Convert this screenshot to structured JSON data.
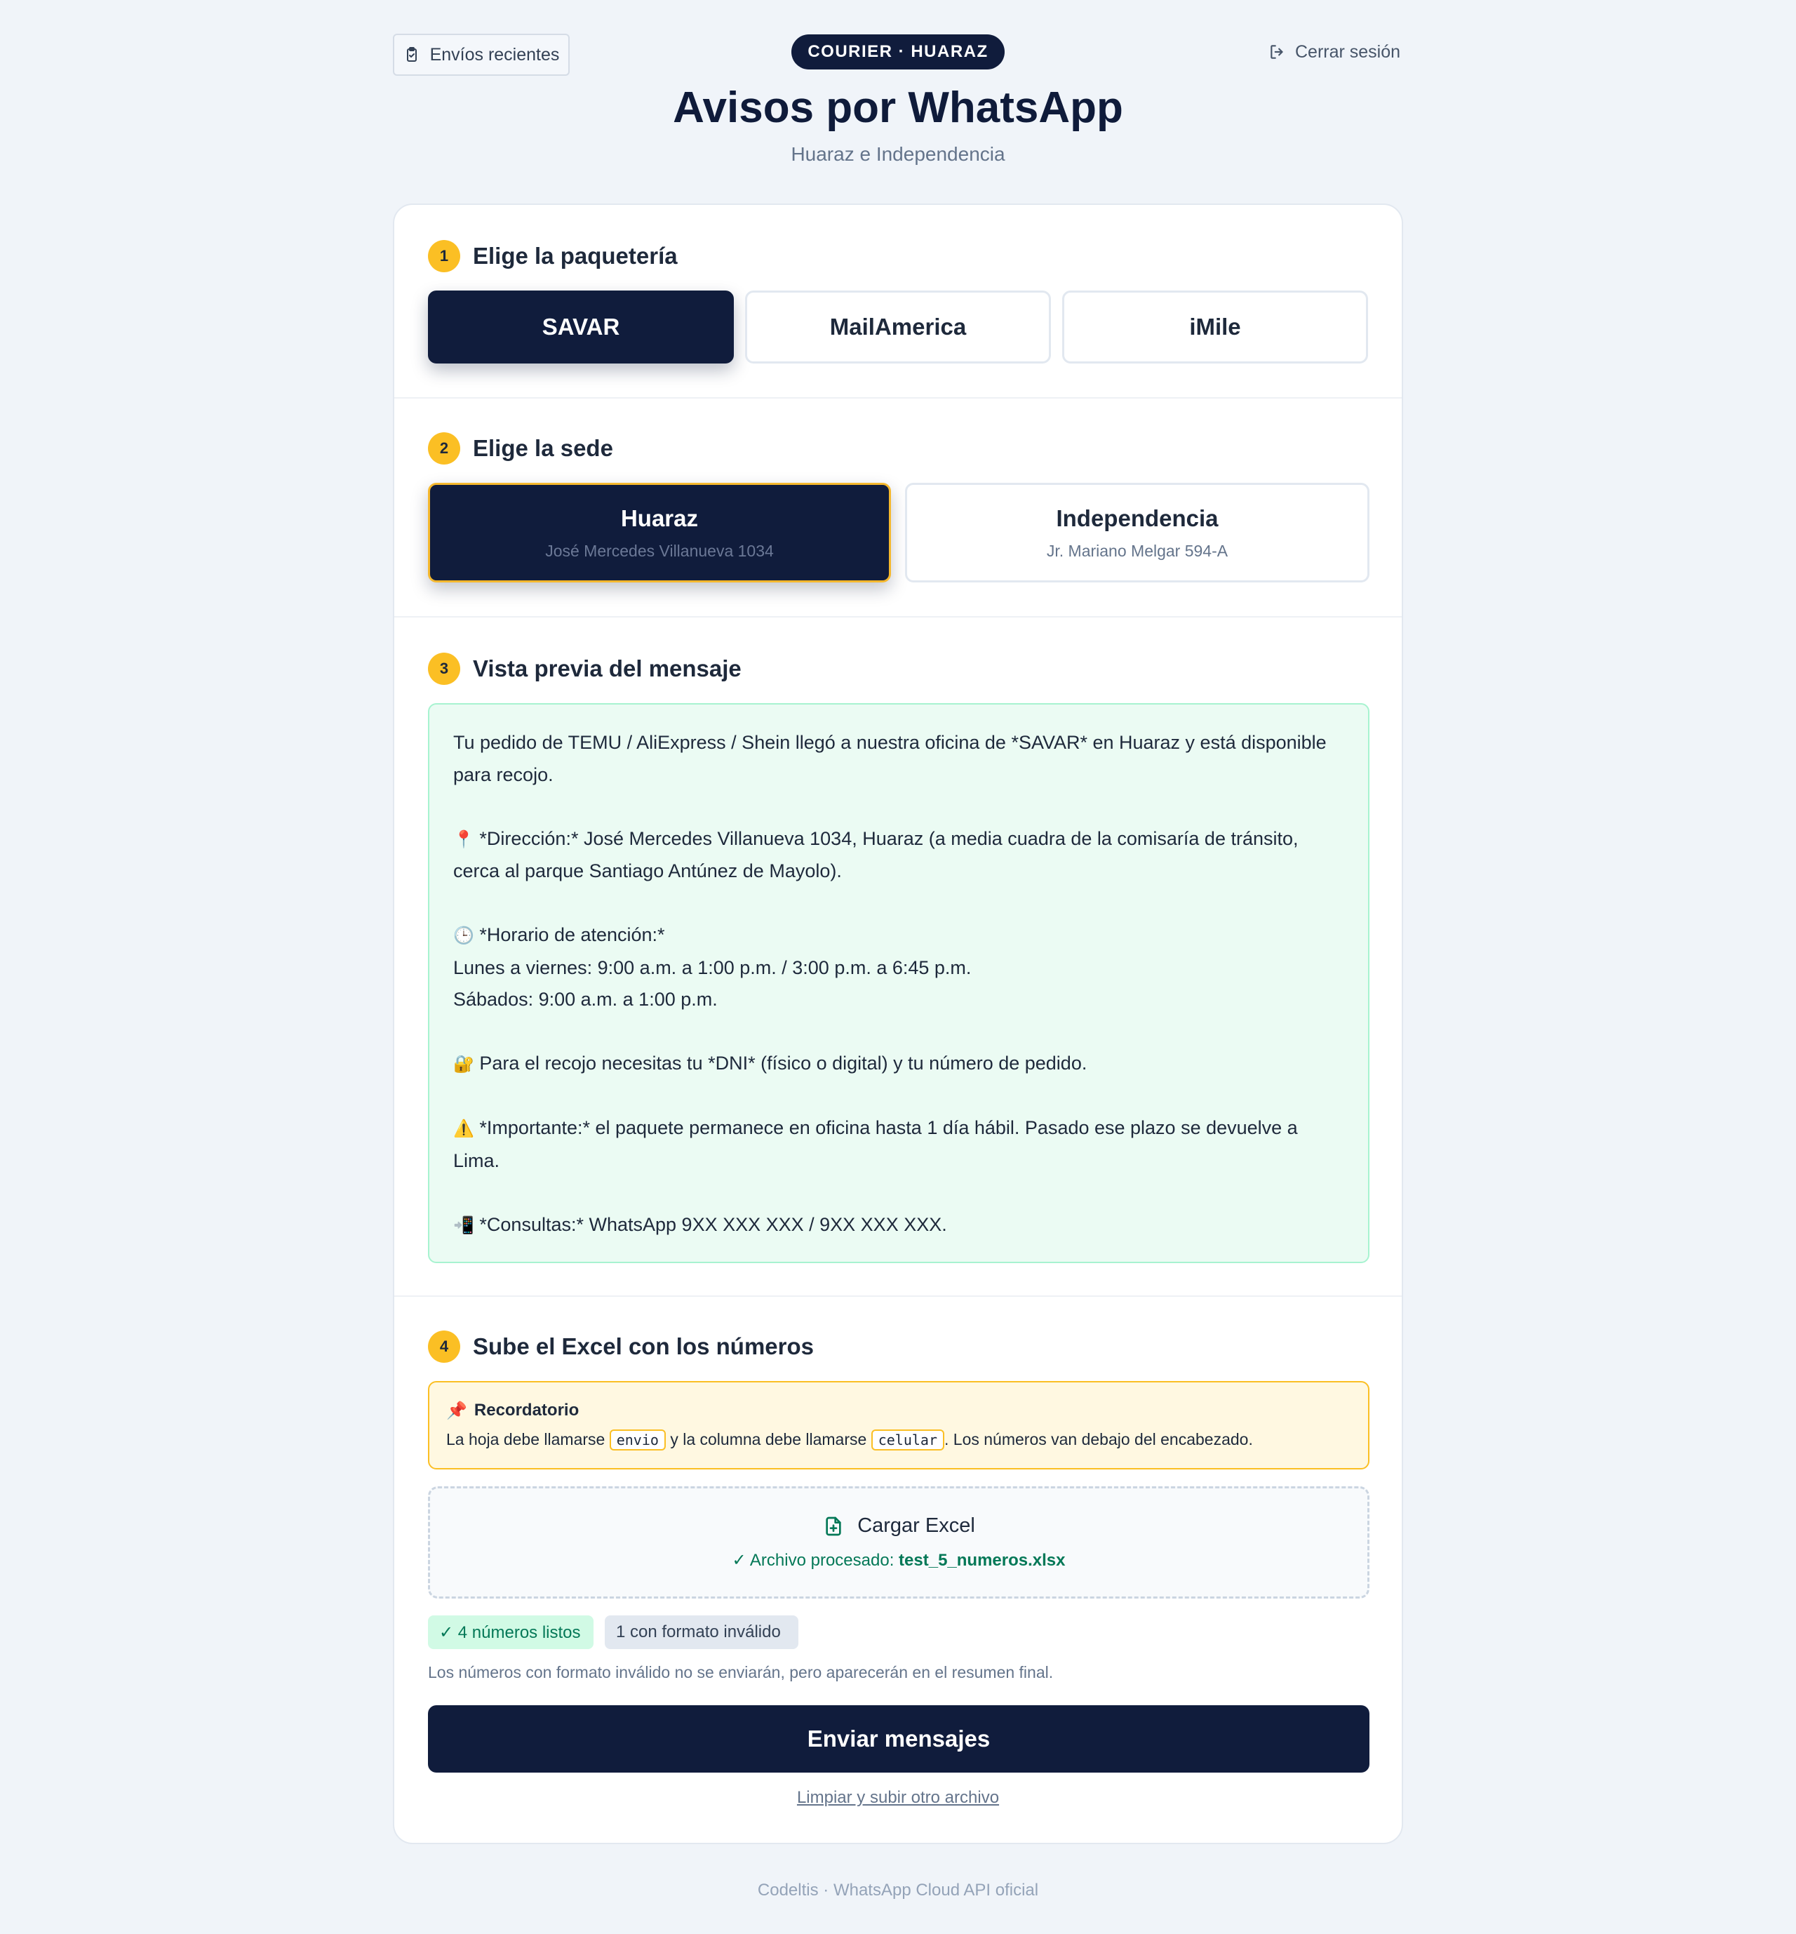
{
  "header": {
    "recent_label": "Envíos recientes",
    "badge": "COURIER · HUARAZ",
    "logout_label": "Cerrar sesión",
    "title": "Avisos por WhatsApp",
    "subtitle": "Huaraz e Independencia"
  },
  "steps": [
    {
      "num": "1",
      "title": "Elige la paquetería"
    },
    {
      "num": "2",
      "title": "Elige la sede"
    },
    {
      "num": "3",
      "title": "Vista previa del mensaje"
    },
    {
      "num": "4",
      "title": "Sube el Excel con los números"
    }
  ],
  "carriers": [
    {
      "label": "SAVAR",
      "selected": true
    },
    {
      "label": "MailAmerica",
      "selected": false
    },
    {
      "label": "iMile",
      "selected": false
    }
  ],
  "sedes": [
    {
      "name": "Huaraz",
      "address": "José Mercedes Villanueva 1034",
      "selected": true
    },
    {
      "name": "Independencia",
      "address": "Jr. Mariano Melgar 594-A",
      "selected": false
    }
  ],
  "preview": {
    "p1": "Tu pedido de TEMU / AliExpress / Shein llegó a nuestra oficina de *SAVAR* en Huaraz y está disponible para recojo.",
    "p2_icon": "📍",
    "p2": "*Dirección:* José Mercedes Villanueva 1034, Huaraz (a media cuadra de la comisaría de tránsito, cerca al parque Santiago Antúnez de Mayolo).",
    "p3_icon": "🕒",
    "p3": "*Horario de atención:*",
    "p3_line2": "Lunes a viernes: 9:00 a.m. a 1:00 p.m. / 3:00 p.m. a 6:45 p.m.",
    "p3_line3": "Sábados: 9:00 a.m. a 1:00 p.m.",
    "p4_icon": "🔐",
    "p4": "Para el recojo necesitas tu *DNI* (físico o digital) y tu número de pedido.",
    "p5_icon": "⚠️",
    "p5": "*Importante:* el paquete permanece en oficina hasta 1 día hábil. Pasado ese plazo se devuelve a Lima.",
    "p6_icon": "📲",
    "p6": "*Consultas:* WhatsApp 9XX XXX XXX / 9XX XXX XXX."
  },
  "reminder": {
    "icon": "📌",
    "title": "Recordatorio",
    "text_a": "La hoja debe llamarse",
    "code_sheet": "envio",
    "text_b": "y la columna debe llamarse",
    "code_col": "celular",
    "text_c": ". Los números van debajo del encabezado."
  },
  "upload": {
    "label": "Cargar Excel",
    "status_prefix": "✓ Archivo procesado:",
    "filename": "test_5_numeros.xlsx"
  },
  "counts": {
    "ok": "✓ 4 números listos",
    "invalid": "1 con formato inválido",
    "note": "Los números con formato inválido no se enviarán, pero aparecerán en el resumen final."
  },
  "actions": {
    "send": "Enviar mensajes",
    "clear": "Limpiar y subir otro archivo"
  },
  "footer": "Codeltis · WhatsApp Cloud API oficial",
  "colors": {
    "navy": "#101c3c",
    "accent": "#fbbf24",
    "preview_bg": "#ebfbf3",
    "success": "#047857"
  }
}
